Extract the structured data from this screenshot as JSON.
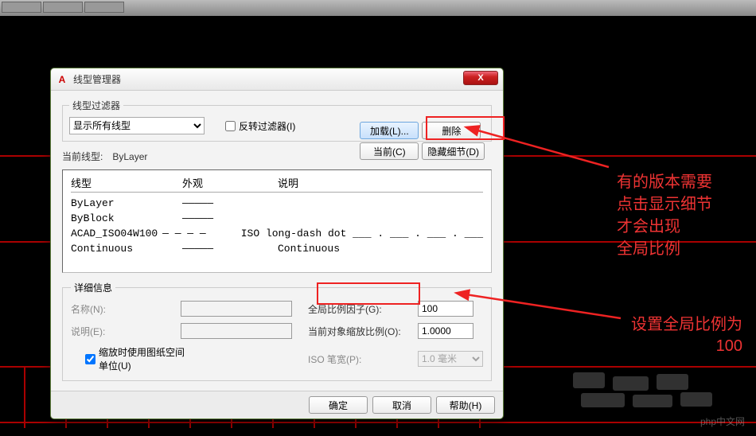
{
  "dialog": {
    "title": "线型管理器",
    "filter_group_label": "线型过滤器",
    "filter_dropdown": "显示所有线型",
    "invert_checkbox_label": "反转过滤器(I)",
    "buttons": {
      "load": "加载(L)...",
      "delete": "删除",
      "current": "当前(C)",
      "hide_details": "隐藏细节(D)",
      "ok": "确定",
      "cancel": "取消",
      "help": "帮助(H)"
    },
    "current_linetype_label": "当前线型:",
    "current_linetype_value": "ByLayer",
    "table_headers": {
      "name": "线型",
      "appearance": "外观",
      "desc": "说明"
    },
    "linetypes": [
      {
        "name": "ByLayer",
        "appearance": "—————",
        "desc": ""
      },
      {
        "name": "ByBlock",
        "appearance": "—————",
        "desc": ""
      },
      {
        "name": "ACAD_ISO04W100",
        "appearance": "— — — —",
        "desc": "ISO long-dash dot ___ . ___ . ___ . ___"
      },
      {
        "name": "Continuous",
        "appearance": "—————",
        "desc": "Continuous"
      }
    ],
    "details": {
      "group_label": "详细信息",
      "name_label": "名称(N):",
      "desc_label": "说明(E):",
      "use_paperspace_label": "缩放时使用图纸空间单位(U)",
      "global_scale_label": "全局比例因子(G):",
      "global_scale_value": "100",
      "object_scale_label": "当前对象缩放比例(O):",
      "object_scale_value": "1.0000",
      "iso_pen_label": "ISO 笔宽(P):",
      "iso_pen_value": "1.0 毫米"
    }
  },
  "annotations": {
    "a1_l1": "有的版本需要",
    "a1_l2": "点击显示细节",
    "a1_l3": "才会出现",
    "a1_l4": "全局比例",
    "a2_l1": "设置全局比例为",
    "a2_l2": "100"
  },
  "watermark": "php中文网"
}
